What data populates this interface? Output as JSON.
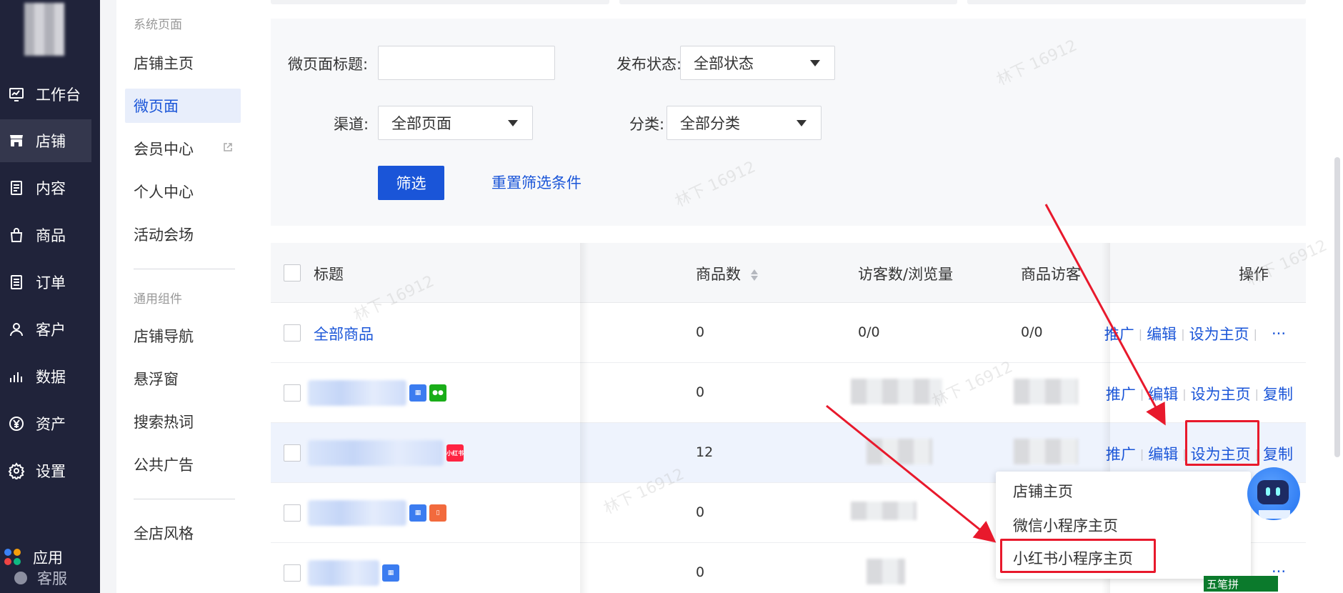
{
  "nav": {
    "items": [
      {
        "label": "工作台",
        "icon": "dashboard-icon"
      },
      {
        "label": "店铺",
        "icon": "store-icon",
        "active": true
      },
      {
        "label": "内容",
        "icon": "content-icon"
      },
      {
        "label": "商品",
        "icon": "bag-icon"
      },
      {
        "label": "订单",
        "icon": "order-icon"
      },
      {
        "label": "客户",
        "icon": "user-icon"
      },
      {
        "label": "数据",
        "icon": "chart-icon"
      },
      {
        "label": "资产",
        "icon": "yuan-icon"
      },
      {
        "label": "设置",
        "icon": "gear-icon"
      }
    ],
    "apps_label": "应用",
    "service_label": "客服"
  },
  "submenu": {
    "group1": "系统页面",
    "items1": [
      "店铺主页",
      "微页面",
      "会员中心",
      "个人中心",
      "活动会场"
    ],
    "group2": "通用组件",
    "items2": [
      "店铺导航",
      "悬浮窗",
      "搜索热词",
      "公共广告"
    ],
    "items3": [
      "全店风格"
    ]
  },
  "filter": {
    "title_label": "微页面标题:",
    "title_value": "",
    "status_label": "发布状态:",
    "status_value": "全部状态",
    "channel_label": "渠道:",
    "channel_value": "全部页面",
    "category_label": "分类:",
    "category_value": "全部分类",
    "submit_label": "筛选",
    "reset_label": "重置筛选条件"
  },
  "table": {
    "headers": {
      "title": "标题",
      "goods": "商品数",
      "visits": "访客数/浏览量",
      "goods_visits": "商品访客",
      "ops": "操作"
    },
    "rows": [
      {
        "title": "全部商品",
        "goods": "0",
        "visits": "0/0",
        "goods_visits": "0/0",
        "ops": [
          "推广",
          "编辑",
          "设为主页",
          "···"
        ]
      },
      {
        "title": "",
        "goods": "0",
        "visits": "",
        "goods_visits": "",
        "ops": [
          "推广",
          "编辑",
          "设为主页",
          "复制"
        ]
      },
      {
        "title": "",
        "goods": "12",
        "visits": "",
        "goods_visits": "",
        "ops": [
          "推广",
          "编辑",
          "设为主页",
          "复制"
        ]
      },
      {
        "title": "",
        "goods": "0",
        "visits": "",
        "goods_visits": "",
        "ops": []
      },
      {
        "title": "",
        "goods": "0",
        "visits": "",
        "goods_visits": "",
        "ops": [
          "···"
        ]
      }
    ]
  },
  "dropdown": {
    "items": [
      "店铺主页",
      "微信小程序主页",
      "小红书小程序主页"
    ]
  },
  "badges": {
    "xhs": "小红书"
  },
  "ime": {
    "label": "五笔拼"
  },
  "watermark": "林下 16912",
  "colors": {
    "primary": "#1a55d8",
    "nav_bg": "#20233a",
    "highlight": "#e8192c"
  }
}
